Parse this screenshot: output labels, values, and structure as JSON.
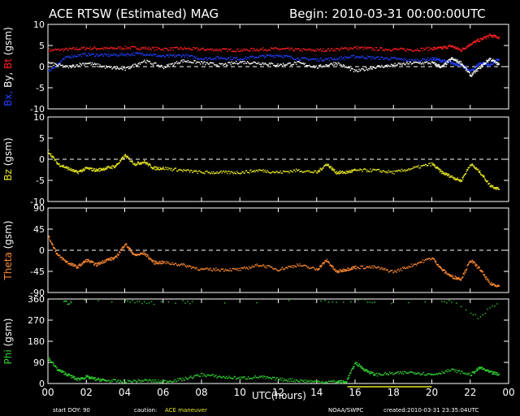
{
  "header": {
    "title": "ACE RTSW (Estimated) MAG",
    "begin": "Begin: 2010-03-31 00:00:00UTC"
  },
  "footer": {
    "start_doy": "start DOY:   90",
    "caution_label": "caution:",
    "caution_text": "ACE maneuver",
    "source": "NOAA/SWPC",
    "created": "created:2010-03-31 23:35:04UTC"
  },
  "colors": {
    "bx": "#2040ff",
    "by": "#ffffff",
    "bt": "#ff2020",
    "bz": "#e8e820",
    "theta": "#ff8a30",
    "phi": "#30d030",
    "maneuver": "#e8e820",
    "zero_line": "#ffffff"
  },
  "chart_data": [
    {
      "type": "scatter",
      "panel": "btxyz",
      "ylabel_parts": [
        "Bx,",
        " By,",
        " Bt"
      ],
      "ylabel_suffix": "(gsm)",
      "ylim": [
        -10,
        10
      ],
      "yticks": [
        "10",
        "5",
        "0",
        "-5",
        "-10"
      ],
      "ytick_values": [
        10,
        5,
        0,
        -5,
        -10
      ],
      "zero_line": true,
      "series": [
        {
          "name": "Bt",
          "x": [
            0,
            1,
            2,
            3,
            4,
            5,
            6,
            7,
            8,
            9,
            10,
            11,
            12,
            13,
            14,
            15,
            16,
            17,
            18,
            19,
            20,
            20.5,
            21,
            21.5,
            22,
            22.5,
            23,
            23.5
          ],
          "y": [
            4,
            4.2,
            4.5,
            4.4,
            4.6,
            4.5,
            4.3,
            4.4,
            4.2,
            4.1,
            4.0,
            4.2,
            4.3,
            4.1,
            4.0,
            4.2,
            4.6,
            4.3,
            4.2,
            4.1,
            4.4,
            4.5,
            5.0,
            4.0,
            5.5,
            6.5,
            7.5,
            7.0
          ]
        },
        {
          "name": "Bx",
          "x": [
            0,
            1,
            2,
            3,
            4,
            5,
            6,
            7,
            8,
            9,
            10,
            11,
            12,
            13,
            14,
            15,
            16,
            17,
            18,
            19,
            20,
            20.5,
            21,
            21.5,
            22,
            22.5,
            23,
            23.5
          ],
          "y": [
            -1,
            2.5,
            3,
            2.8,
            3,
            3.2,
            2.5,
            2.8,
            2,
            2.2,
            2,
            2.5,
            2.8,
            2,
            1.8,
            2,
            2.5,
            2.2,
            2,
            1.5,
            2,
            1.5,
            1,
            0.5,
            -1,
            1,
            0.5,
            2
          ]
        },
        {
          "name": "By",
          "x": [
            0,
            1,
            2,
            3,
            4,
            5,
            6,
            7,
            8,
            9,
            10,
            11,
            12,
            13,
            14,
            15,
            16,
            17,
            18,
            19,
            20,
            20.5,
            21,
            21.5,
            22,
            22.5,
            23,
            23.5
          ],
          "y": [
            1,
            0,
            1,
            0,
            -0.5,
            1.5,
            0,
            1.5,
            1,
            0.5,
            1.2,
            1,
            0.5,
            1,
            0,
            1,
            -1,
            0,
            0.5,
            1,
            1,
            0,
            2,
            1,
            -2,
            0,
            2,
            0.5
          ]
        }
      ]
    },
    {
      "type": "scatter",
      "panel": "bz",
      "ylabel": "Bz",
      "ylabel_suffix": "(gsm)",
      "ylim": [
        -10,
        10
      ],
      "yticks": [
        "10",
        "5",
        "0",
        "-5",
        "-10"
      ],
      "ytick_values": [
        10,
        5,
        0,
        -5,
        -10
      ],
      "zero_line": true,
      "series": [
        {
          "name": "Bz",
          "x": [
            0,
            0.5,
            1,
            1.5,
            2,
            2.5,
            3,
            3.5,
            4,
            4.5,
            5,
            5.5,
            6,
            7,
            8,
            9,
            10,
            11,
            12,
            13,
            14,
            14.5,
            15,
            15.5,
            16,
            17,
            18,
            19,
            20,
            20.5,
            21,
            21.5,
            22,
            22.5,
            23,
            23.5
          ],
          "y": [
            2,
            -1,
            -2,
            -3,
            -2,
            -2.5,
            -2,
            -1.5,
            1,
            -1,
            -0.5,
            -2,
            -2,
            -2.5,
            -3,
            -3,
            -3,
            -2.5,
            -3,
            -2.5,
            -3,
            -1,
            -3,
            -3,
            -2.5,
            -2.5,
            -3,
            -2,
            -1,
            -3,
            -4,
            -5,
            -1,
            -3,
            -6,
            -7
          ]
        }
      ]
    },
    {
      "type": "scatter",
      "panel": "theta",
      "ylabel": "Theta",
      "ylabel_suffix": "(gsm)",
      "ylim": [
        -90,
        90
      ],
      "yticks": [
        "90",
        "45",
        "0",
        "-45",
        "-90"
      ],
      "ytick_values": [
        90,
        45,
        0,
        -45,
        -90
      ],
      "zero_line": true,
      "series": [
        {
          "name": "Theta",
          "x": [
            0,
            0.5,
            1,
            1.5,
            2,
            2.5,
            3,
            3.5,
            4,
            4.5,
            5,
            5.5,
            6,
            7,
            8,
            9,
            10,
            11,
            12,
            13,
            14,
            14.5,
            15,
            15.5,
            16,
            17,
            18,
            19,
            20,
            20.5,
            21,
            21.5,
            22,
            22.5,
            23,
            23.5
          ],
          "y": [
            30,
            -10,
            -25,
            -35,
            -20,
            -30,
            -20,
            -15,
            15,
            -10,
            -5,
            -25,
            -25,
            -30,
            -40,
            -40,
            -40,
            -30,
            -40,
            -30,
            -40,
            -20,
            -45,
            -40,
            -35,
            -35,
            -45,
            -30,
            -15,
            -40,
            -55,
            -60,
            -20,
            -40,
            -70,
            -75
          ]
        }
      ]
    },
    {
      "type": "scatter",
      "panel": "phi",
      "ylabel": "Phi",
      "ylabel_suffix": "(gsm)",
      "ylim": [
        0,
        360
      ],
      "yticks": [
        "360",
        "270",
        "180",
        "90",
        "0"
      ],
      "ytick_values": [
        360,
        270,
        180,
        90,
        0
      ],
      "zero_line": false,
      "series": [
        {
          "name": "Phi-low",
          "x": [
            0,
            0.5,
            1,
            1.5,
            2,
            2.5,
            3,
            4,
            5,
            6,
            7,
            8,
            9,
            10,
            11,
            12,
            13,
            14,
            15,
            15.5,
            16,
            16.5,
            17,
            18,
            19,
            20,
            21,
            22,
            22.5,
            23,
            23.5
          ],
          "y": [
            110,
            60,
            40,
            20,
            30,
            20,
            15,
            10,
            15,
            10,
            20,
            40,
            30,
            25,
            30,
            20,
            15,
            10,
            10,
            8,
            90,
            60,
            40,
            45,
            50,
            40,
            60,
            40,
            70,
            50,
            40
          ]
        },
        {
          "name": "Phi-high",
          "x": [
            0.8,
            1.0,
            1.2,
            4.0,
            4.5,
            5.0,
            5.5,
            7.0,
            7.5,
            14.2,
            15.0,
            16.5,
            17.0,
            20.5,
            21.0,
            22.0,
            22.5,
            23.0,
            23.5
          ],
          "y": [
            355,
            345,
            350,
            355,
            348,
            350,
            345,
            352,
            348,
            355,
            350,
            355,
            345,
            350,
            355,
            300,
            280,
            330,
            340
          ]
        }
      ]
    }
  ],
  "xaxis": {
    "label": "UTC(hours)",
    "ticks": [
      "00",
      "02",
      "04",
      "06",
      "08",
      "10",
      "12",
      "14",
      "16",
      "18",
      "20",
      "22",
      "00"
    ],
    "tick_values": [
      0,
      2,
      4,
      6,
      8,
      10,
      12,
      14,
      16,
      18,
      20,
      22,
      24
    ],
    "xlim": [
      0,
      24
    ],
    "maneuver_range": [
      15.6,
      20.0
    ]
  }
}
